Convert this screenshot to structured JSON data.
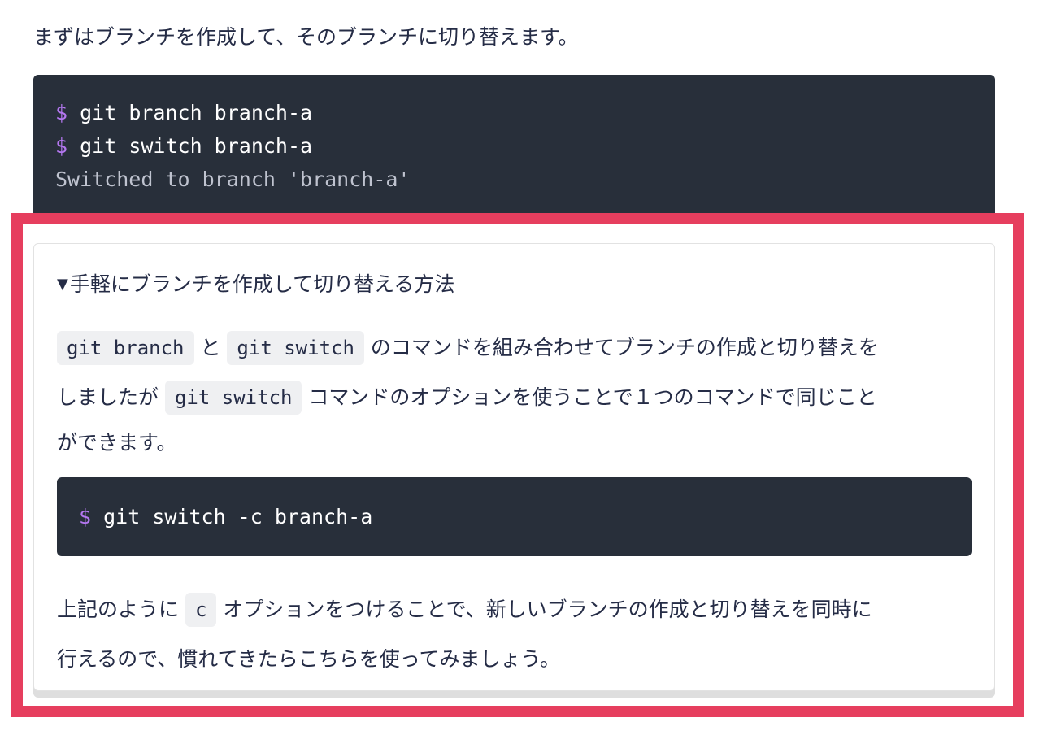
{
  "intro_text": "まずはブランチを作成して、そのブランチに切り替えます。",
  "code_block_top": {
    "lines": [
      {
        "prompt": "$",
        "command": " git branch branch-a"
      },
      {
        "prompt": "$",
        "command": " git switch branch-a"
      }
    ],
    "output": "Switched to branch 'branch-a'"
  },
  "details": {
    "summary_marker": "▼",
    "summary": "手軽にブランチを作成して切り替える方法",
    "paragraph1": {
      "code1": "git branch",
      "text1": "と",
      "code2": "git switch",
      "text2": "のコマンドを組み合わせてブランチの作成と切り替えを",
      "text3": "しましたが",
      "code3": "git switch",
      "text4": "コマンドのオプションを使うことで１つのコマンドで同じこと",
      "text5": "ができます。"
    },
    "code_block": {
      "prompt": "$",
      "command": " git switch -c branch-a"
    },
    "paragraph2": {
      "text1": "上記のように",
      "code1": "c",
      "text2": "オプションをつけることで、新しいブランチの作成と切り替えを同時に",
      "text3": "行えるので、慣れてきたらこちらを使ってみましょう。"
    }
  },
  "colors": {
    "highlight_border": "#e63e5e",
    "code_background": "#282f3a",
    "prompt": "#b477f0",
    "inline_code_background": "#eff0f2",
    "text": "#252c46"
  }
}
